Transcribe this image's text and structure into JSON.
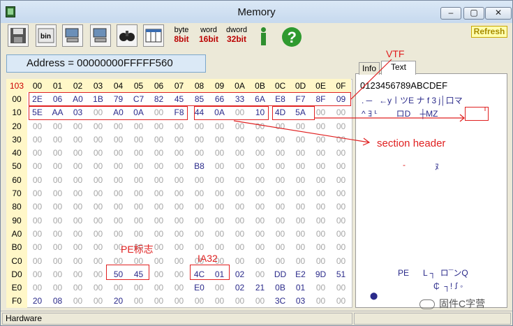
{
  "window": {
    "title": "Memory",
    "controls": {
      "minimize": "–",
      "maximize": "▢",
      "close": "✕"
    }
  },
  "toolbar": {
    "buttons": [
      {
        "icon": "floppy-disk-icon"
      },
      {
        "icon": "bin-file-icon",
        "label": "bin"
      },
      {
        "icon": "computer-icon"
      },
      {
        "icon": "computer-icon"
      },
      {
        "icon": "binoculars-icon"
      },
      {
        "icon": "window-grid-icon"
      }
    ],
    "byte": {
      "top": "byte",
      "bottom": "8bit"
    },
    "word": {
      "top": "word",
      "bottom": "16bit"
    },
    "dword": {
      "top": "dword",
      "bottom": "32bit"
    },
    "info_icon": "info-icon",
    "help_icon": "help-question-icon",
    "refresh": "Refresh"
  },
  "address": "Address = 00000000FFFFF560",
  "grid": {
    "corner": "103",
    "columns": [
      "00",
      "01",
      "02",
      "03",
      "04",
      "05",
      "06",
      "07",
      "08",
      "09",
      "0A",
      "0B",
      "0C",
      "0D",
      "0E",
      "0F"
    ],
    "rows": [
      {
        "label": "00",
        "cells": [
          "2E",
          "06",
          "A0",
          "1B",
          "79",
          "C7",
          "82",
          "45",
          "85",
          "66",
          "33",
          "6A",
          "E8",
          "F7",
          "8F",
          "09"
        ]
      },
      {
        "label": "10",
        "cells": [
          "5E",
          "AA",
          "03",
          "00",
          "A0",
          "0A",
          "00",
          "F8",
          "44",
          "0A",
          "00",
          "10",
          "4D",
          "5A",
          "00",
          "00"
        ]
      },
      {
        "label": "20",
        "cells": [
          "00",
          "00",
          "00",
          "00",
          "00",
          "00",
          "00",
          "00",
          "00",
          "00",
          "00",
          "00",
          "00",
          "00",
          "00",
          "00"
        ]
      },
      {
        "label": "30",
        "cells": [
          "00",
          "00",
          "00",
          "00",
          "00",
          "00",
          "00",
          "00",
          "00",
          "00",
          "00",
          "00",
          "00",
          "00",
          "00",
          "00"
        ]
      },
      {
        "label": "40",
        "cells": [
          "00",
          "00",
          "00",
          "00",
          "00",
          "00",
          "00",
          "00",
          "00",
          "00",
          "00",
          "00",
          "00",
          "00",
          "00",
          "00"
        ]
      },
      {
        "label": "50",
        "cells": [
          "00",
          "00",
          "00",
          "00",
          "00",
          "00",
          "00",
          "00",
          "B8",
          "00",
          "00",
          "00",
          "00",
          "00",
          "00",
          "00"
        ]
      },
      {
        "label": "60",
        "cells": [
          "00",
          "00",
          "00",
          "00",
          "00",
          "00",
          "00",
          "00",
          "00",
          "00",
          "00",
          "00",
          "00",
          "00",
          "00",
          "00"
        ]
      },
      {
        "label": "70",
        "cells": [
          "00",
          "00",
          "00",
          "00",
          "00",
          "00",
          "00",
          "00",
          "00",
          "00",
          "00",
          "00",
          "00",
          "00",
          "00",
          "00"
        ]
      },
      {
        "label": "80",
        "cells": [
          "00",
          "00",
          "00",
          "00",
          "00",
          "00",
          "00",
          "00",
          "00",
          "00",
          "00",
          "00",
          "00",
          "00",
          "00",
          "00"
        ]
      },
      {
        "label": "90",
        "cells": [
          "00",
          "00",
          "00",
          "00",
          "00",
          "00",
          "00",
          "00",
          "00",
          "00",
          "00",
          "00",
          "00",
          "00",
          "00",
          "00"
        ]
      },
      {
        "label": "A0",
        "cells": [
          "00",
          "00",
          "00",
          "00",
          "00",
          "00",
          "00",
          "00",
          "00",
          "00",
          "00",
          "00",
          "00",
          "00",
          "00",
          "00"
        ]
      },
      {
        "label": "B0",
        "cells": [
          "00",
          "00",
          "00",
          "00",
          "00",
          "00",
          "00",
          "00",
          "00",
          "00",
          "00",
          "00",
          "00",
          "00",
          "00",
          "00"
        ]
      },
      {
        "label": "C0",
        "cells": [
          "00",
          "00",
          "00",
          "00",
          "00",
          "00",
          "00",
          "00",
          "00",
          "00",
          "00",
          "00",
          "00",
          "00",
          "00",
          "00"
        ]
      },
      {
        "label": "D0",
        "cells": [
          "00",
          "00",
          "00",
          "00",
          "50",
          "45",
          "00",
          "00",
          "4C",
          "01",
          "02",
          "00",
          "DD",
          "E2",
          "9D",
          "51"
        ]
      },
      {
        "label": "E0",
        "cells": [
          "00",
          "00",
          "00",
          "00",
          "00",
          "00",
          "00",
          "00",
          "E0",
          "00",
          "02",
          "21",
          "0B",
          "01",
          "00",
          "00"
        ]
      },
      {
        "label": "F0",
        "cells": [
          "20",
          "08",
          "00",
          "00",
          "20",
          "00",
          "00",
          "00",
          "00",
          "00",
          "00",
          "00",
          "3C",
          "03",
          "00",
          "00"
        ]
      }
    ],
    "highlight": [
      "2E",
      "06",
      "A0",
      "1B",
      "79",
      "C7",
      "82",
      "45",
      "85",
      "66",
      "33",
      "6A",
      "E8",
      "F7",
      "8F",
      "09",
      "5E",
      "AA",
      "03",
      "A0",
      "0A",
      "F8",
      "44",
      "4D",
      "5A",
      "10",
      "B8",
      "50",
      "45",
      "4C",
      "01",
      "02",
      "DD",
      "E2",
      "9D",
      "51",
      "E0",
      "21",
      "0B",
      "20",
      "08",
      "3C"
    ]
  },
  "panel": {
    "tabs": [
      "Info",
      "Text"
    ],
    "hex_header": "0123456789ABCDEF",
    "text_lines": [
      {
        "text": ". ─   ←y㇑ツE ナ f 3 j│口マ"
      },
      {
        "text": "^ ﾖ ᒻ        ロD    ┼MZ"
      },
      {
        "text": "PE      L ┐  ロ¯ンQ"
      },
      {
        "text": "₵  ┐! ꭍ ◦"
      }
    ],
    "dot1": "-",
    "dot2": "ﾇ",
    "marker": "⬤"
  },
  "annotations": {
    "vtf": "VTF",
    "section_header": "section header",
    "pe_sign": "PE标志",
    "ia32": "IA32"
  },
  "status": {
    "left": "Hardware"
  },
  "watermark": "固件C字营",
  "colors": {
    "annotation": "#e02020",
    "highlight_text": "#2a2a8a",
    "header_bg": "#fff7c8"
  }
}
